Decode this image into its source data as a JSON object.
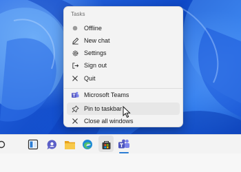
{
  "menu": {
    "header": "Tasks",
    "items": [
      {
        "label": "Offline",
        "icon": "status-dot-icon"
      },
      {
        "label": "New chat",
        "icon": "compose-icon"
      },
      {
        "label": "Settings",
        "icon": "gear-icon"
      },
      {
        "label": "Sign out",
        "icon": "sign-out-icon"
      },
      {
        "label": "Quit",
        "icon": "close-icon"
      },
      {
        "label": "Microsoft Teams",
        "icon": "teams-icon"
      },
      {
        "label": "Pin to taskbar",
        "icon": "pin-icon"
      },
      {
        "label": "Close all windows",
        "icon": "close-icon"
      }
    ]
  },
  "taskbar": {
    "icons": [
      "start-icon",
      "snap-layout-icon",
      "chat-icon",
      "file-explorer-icon",
      "edge-icon",
      "store-icon",
      "teams-icon"
    ]
  },
  "colors": {
    "wallpaper": "#1553d8",
    "menu_bg": "#f3f3f3",
    "teams_purple": "#5b5fc7",
    "edge_blue": "#1e8ad6",
    "folder_yellow": "#f4c443"
  }
}
